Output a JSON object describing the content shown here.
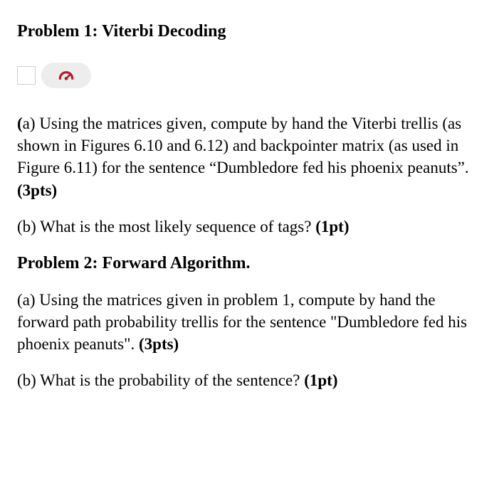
{
  "problem1": {
    "title": "Problem 1: Viterbi Decoding",
    "a_lead": "(",
    "a_letter": "a",
    "a_close": ") ",
    "a_text": "Using the matrices given, compute by hand the Viterbi trellis (as shown in Figures 6.10 and 6.12) and backpointer matrix (as used in Figure 6.11) for the sentence “Dumbledore fed his phoenix peanuts”. ",
    "a_points": "(3pts)",
    "b_text": "(b) What is the most likely sequence of tags? ",
    "b_points": "(1pt)"
  },
  "problem2": {
    "title": "Problem 2: Forward Algorithm.",
    "a_text": "(a)  Using the matrices given in problem 1, compute by hand the forward path probability trellis for the sentence \"Dumbledore fed his phoenix peanuts\".  ",
    "a_points": "(3pts)",
    "b_text": "(b) What is the probability of the sentence? ",
    "b_points": "(1pt)"
  },
  "icons": {
    "gauge": "gauge-icon"
  }
}
